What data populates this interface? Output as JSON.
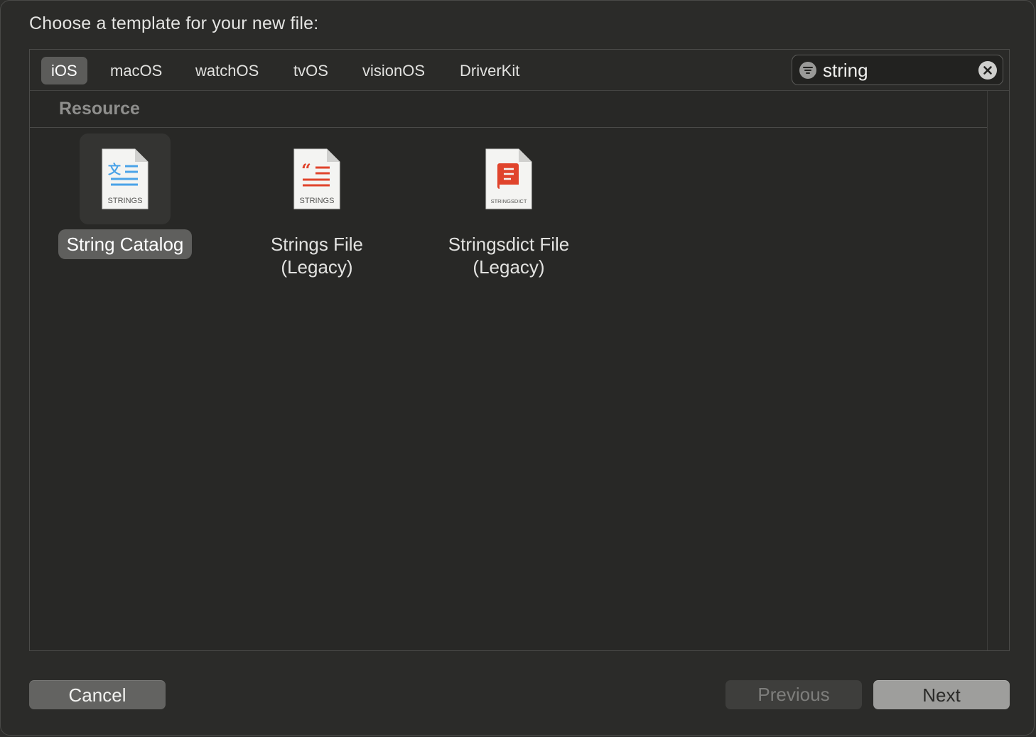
{
  "dialog": {
    "prompt": "Choose a template for your new file:"
  },
  "tabs": [
    {
      "label": "iOS",
      "selected": true
    },
    {
      "label": "macOS",
      "selected": false
    },
    {
      "label": "watchOS",
      "selected": false
    },
    {
      "label": "tvOS",
      "selected": false
    },
    {
      "label": "visionOS",
      "selected": false
    },
    {
      "label": "DriverKit",
      "selected": false
    }
  ],
  "search": {
    "value": "string",
    "filter_icon": "filter-icon",
    "clear_icon": "clear-icon"
  },
  "section": {
    "title": "Resource"
  },
  "templates": [
    {
      "label": "String Catalog",
      "label_line2": "",
      "icon_caption": "STRINGS",
      "icon": "string-catalog-icon",
      "accent": "#4aa3e8",
      "selected": true
    },
    {
      "label": "Strings File",
      "label_line2": "(Legacy)",
      "icon_caption": "STRINGS",
      "icon": "strings-file-icon",
      "accent": "#e0442c",
      "selected": false
    },
    {
      "label": "Stringsdict File",
      "label_line2": "(Legacy)",
      "icon_caption": "STRINGSDICT",
      "icon": "stringsdict-file-icon",
      "accent": "#e0442c",
      "selected": false
    }
  ],
  "buttons": {
    "cancel": "Cancel",
    "previous": "Previous",
    "next": "Next"
  }
}
